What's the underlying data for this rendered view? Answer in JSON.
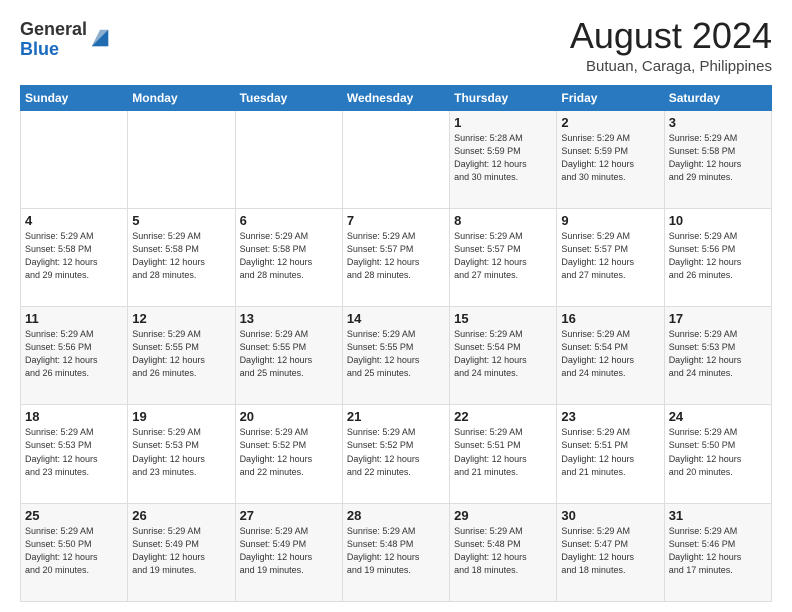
{
  "logo": {
    "line1": "General",
    "line2": "Blue"
  },
  "header": {
    "title": "August 2024",
    "subtitle": "Butuan, Caraga, Philippines"
  },
  "weekdays": [
    "Sunday",
    "Monday",
    "Tuesday",
    "Wednesday",
    "Thursday",
    "Friday",
    "Saturday"
  ],
  "weeks": [
    [
      {
        "day": "",
        "info": ""
      },
      {
        "day": "",
        "info": ""
      },
      {
        "day": "",
        "info": ""
      },
      {
        "day": "",
        "info": ""
      },
      {
        "day": "1",
        "info": "Sunrise: 5:28 AM\nSunset: 5:59 PM\nDaylight: 12 hours\nand 30 minutes."
      },
      {
        "day": "2",
        "info": "Sunrise: 5:29 AM\nSunset: 5:59 PM\nDaylight: 12 hours\nand 30 minutes."
      },
      {
        "day": "3",
        "info": "Sunrise: 5:29 AM\nSunset: 5:58 PM\nDaylight: 12 hours\nand 29 minutes."
      }
    ],
    [
      {
        "day": "4",
        "info": "Sunrise: 5:29 AM\nSunset: 5:58 PM\nDaylight: 12 hours\nand 29 minutes."
      },
      {
        "day": "5",
        "info": "Sunrise: 5:29 AM\nSunset: 5:58 PM\nDaylight: 12 hours\nand 28 minutes."
      },
      {
        "day": "6",
        "info": "Sunrise: 5:29 AM\nSunset: 5:58 PM\nDaylight: 12 hours\nand 28 minutes."
      },
      {
        "day": "7",
        "info": "Sunrise: 5:29 AM\nSunset: 5:57 PM\nDaylight: 12 hours\nand 28 minutes."
      },
      {
        "day": "8",
        "info": "Sunrise: 5:29 AM\nSunset: 5:57 PM\nDaylight: 12 hours\nand 27 minutes."
      },
      {
        "day": "9",
        "info": "Sunrise: 5:29 AM\nSunset: 5:57 PM\nDaylight: 12 hours\nand 27 minutes."
      },
      {
        "day": "10",
        "info": "Sunrise: 5:29 AM\nSunset: 5:56 PM\nDaylight: 12 hours\nand 26 minutes."
      }
    ],
    [
      {
        "day": "11",
        "info": "Sunrise: 5:29 AM\nSunset: 5:56 PM\nDaylight: 12 hours\nand 26 minutes."
      },
      {
        "day": "12",
        "info": "Sunrise: 5:29 AM\nSunset: 5:55 PM\nDaylight: 12 hours\nand 26 minutes."
      },
      {
        "day": "13",
        "info": "Sunrise: 5:29 AM\nSunset: 5:55 PM\nDaylight: 12 hours\nand 25 minutes."
      },
      {
        "day": "14",
        "info": "Sunrise: 5:29 AM\nSunset: 5:55 PM\nDaylight: 12 hours\nand 25 minutes."
      },
      {
        "day": "15",
        "info": "Sunrise: 5:29 AM\nSunset: 5:54 PM\nDaylight: 12 hours\nand 24 minutes."
      },
      {
        "day": "16",
        "info": "Sunrise: 5:29 AM\nSunset: 5:54 PM\nDaylight: 12 hours\nand 24 minutes."
      },
      {
        "day": "17",
        "info": "Sunrise: 5:29 AM\nSunset: 5:53 PM\nDaylight: 12 hours\nand 24 minutes."
      }
    ],
    [
      {
        "day": "18",
        "info": "Sunrise: 5:29 AM\nSunset: 5:53 PM\nDaylight: 12 hours\nand 23 minutes."
      },
      {
        "day": "19",
        "info": "Sunrise: 5:29 AM\nSunset: 5:53 PM\nDaylight: 12 hours\nand 23 minutes."
      },
      {
        "day": "20",
        "info": "Sunrise: 5:29 AM\nSunset: 5:52 PM\nDaylight: 12 hours\nand 22 minutes."
      },
      {
        "day": "21",
        "info": "Sunrise: 5:29 AM\nSunset: 5:52 PM\nDaylight: 12 hours\nand 22 minutes."
      },
      {
        "day": "22",
        "info": "Sunrise: 5:29 AM\nSunset: 5:51 PM\nDaylight: 12 hours\nand 21 minutes."
      },
      {
        "day": "23",
        "info": "Sunrise: 5:29 AM\nSunset: 5:51 PM\nDaylight: 12 hours\nand 21 minutes."
      },
      {
        "day": "24",
        "info": "Sunrise: 5:29 AM\nSunset: 5:50 PM\nDaylight: 12 hours\nand 20 minutes."
      }
    ],
    [
      {
        "day": "25",
        "info": "Sunrise: 5:29 AM\nSunset: 5:50 PM\nDaylight: 12 hours\nand 20 minutes."
      },
      {
        "day": "26",
        "info": "Sunrise: 5:29 AM\nSunset: 5:49 PM\nDaylight: 12 hours\nand 19 minutes."
      },
      {
        "day": "27",
        "info": "Sunrise: 5:29 AM\nSunset: 5:49 PM\nDaylight: 12 hours\nand 19 minutes."
      },
      {
        "day": "28",
        "info": "Sunrise: 5:29 AM\nSunset: 5:48 PM\nDaylight: 12 hours\nand 19 minutes."
      },
      {
        "day": "29",
        "info": "Sunrise: 5:29 AM\nSunset: 5:48 PM\nDaylight: 12 hours\nand 18 minutes."
      },
      {
        "day": "30",
        "info": "Sunrise: 5:29 AM\nSunset: 5:47 PM\nDaylight: 12 hours\nand 18 minutes."
      },
      {
        "day": "31",
        "info": "Sunrise: 5:29 AM\nSunset: 5:46 PM\nDaylight: 12 hours\nand 17 minutes."
      }
    ]
  ]
}
